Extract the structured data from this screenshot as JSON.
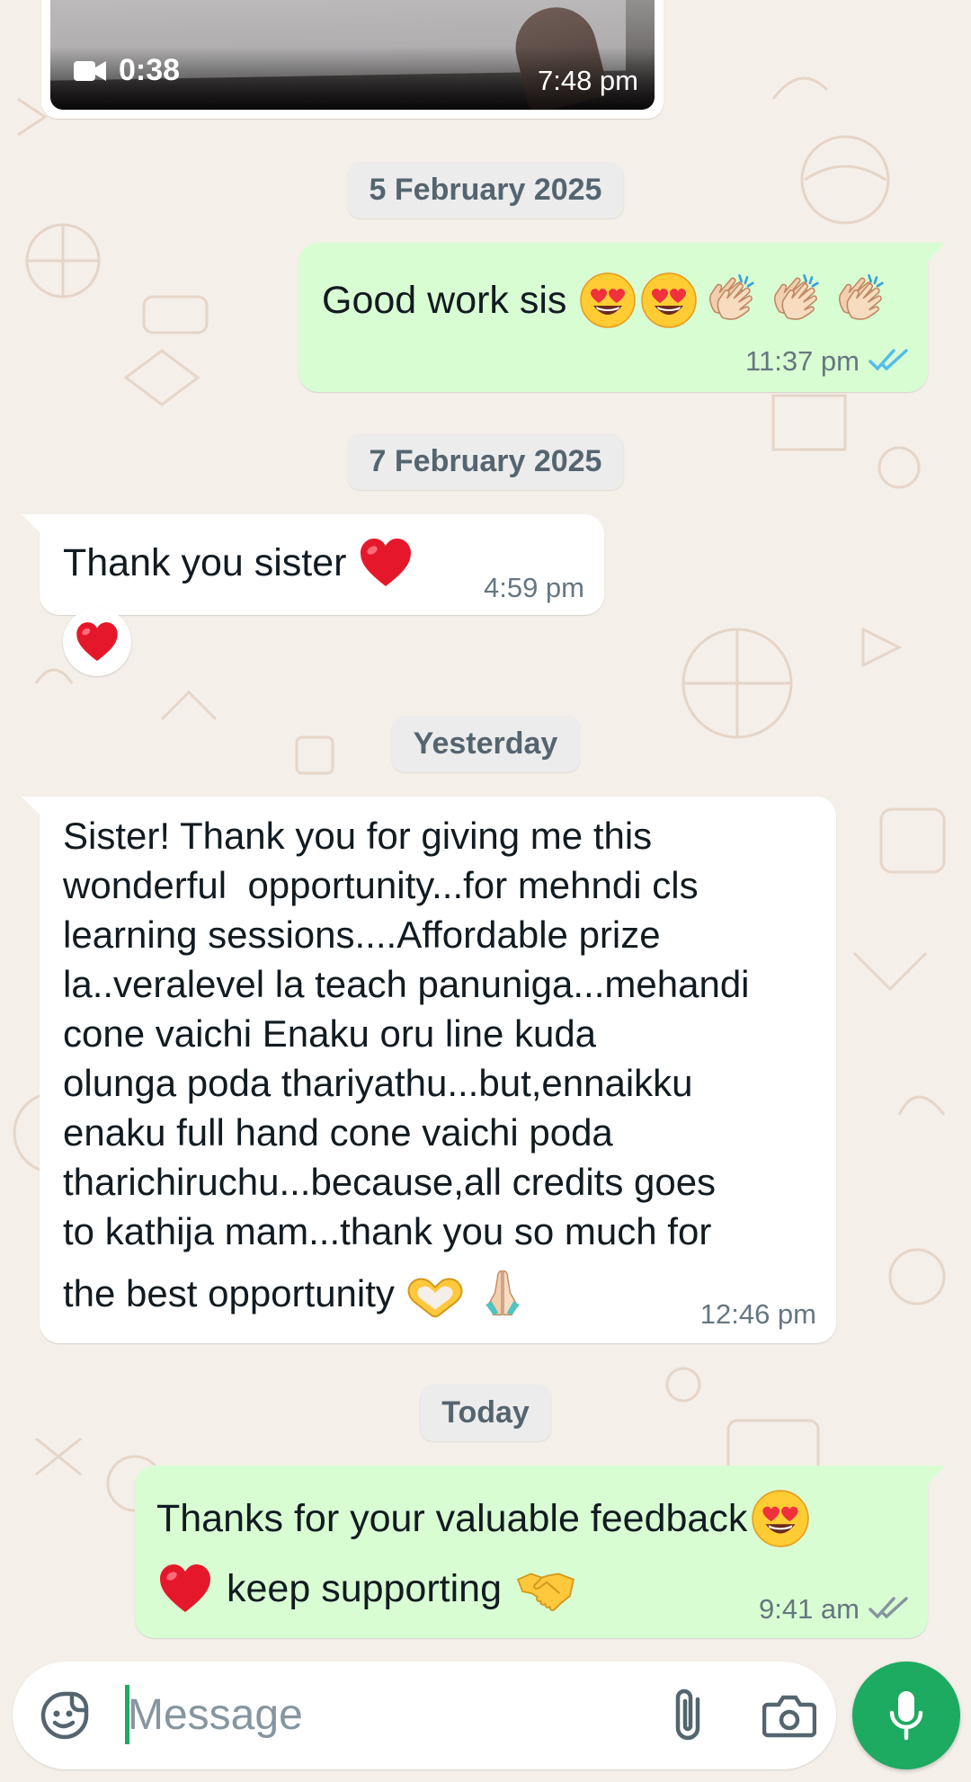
{
  "video_message": {
    "duration": "0:38",
    "time": "7:48 pm",
    "camera_icon": "video-camera-icon"
  },
  "dates": {
    "d1": "5 February 2025",
    "d2": "7 February 2025",
    "d3": "Yesterday",
    "d4": "Today"
  },
  "messages": [
    {
      "direction": "outgoing",
      "text": "Good work sis",
      "emojis": [
        "heart-eyes",
        "heart-eyes",
        "clapping-hands",
        "clapping-hands",
        "clapping-hands"
      ],
      "time": "11:37 pm",
      "status": "read"
    },
    {
      "direction": "incoming",
      "text": "Thank you sister",
      "emojis": [
        "red-heart"
      ],
      "time": "4:59 pm",
      "reaction": "red-heart"
    },
    {
      "direction": "incoming",
      "lines": [
        "Sister! Thank you for giving me this",
        "wonderful  opportunity...for mehndi cls",
        "learning sessions....Affordable prize",
        "la..veralevel la teach panuniga...mehandi",
        "cone vaichi Enaku oru line kuda",
        "olunga poda thariyathu...but,ennaikku",
        "enaku full hand cone vaichi poda",
        "tharichiruchu...because,all credits goes",
        "to kathija mam...thank you so much for",
        "the best opportunity"
      ],
      "emojis": [
        "heart-hands",
        "folded-hands"
      ],
      "time": "12:46 pm"
    },
    {
      "direction": "outgoing",
      "line1": "Thanks for your valuable feedback",
      "line2": "keep supporting",
      "emojis": [
        "heart-eyes",
        "red-heart",
        "handshake"
      ],
      "time": "9:41 am",
      "status": "delivered"
    }
  ],
  "input": {
    "placeholder": "Message",
    "sticker_icon": "sticker-icon",
    "attach_icon": "paperclip-icon",
    "camera_icon": "camera-icon",
    "mic_icon": "microphone-icon"
  },
  "colors": {
    "outgoing_bubble": "#d9fdd3",
    "incoming_bubble": "#ffffff",
    "accent": "#1daa61",
    "read_tick": "#53bdeb",
    "background": "#f4efe8"
  }
}
